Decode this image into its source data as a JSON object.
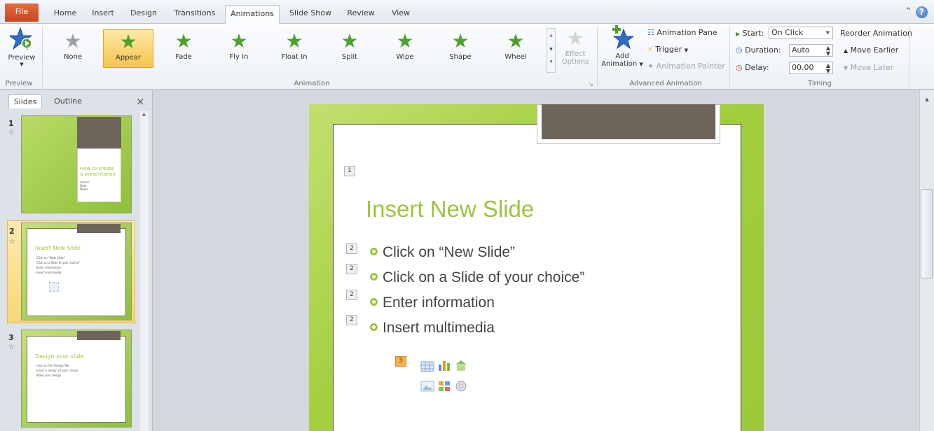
{
  "tabs": [
    "File",
    "Home",
    "Insert",
    "Design",
    "Transitions",
    "Animations",
    "Slide Show",
    "Review",
    "View"
  ],
  "ribbon": {
    "preview": {
      "label": "Preview",
      "group": "Preview"
    },
    "animations": [
      {
        "label": "None",
        "icon": "none-star-icon"
      },
      {
        "label": "Appear",
        "icon": "appear-star-icon"
      },
      {
        "label": "Fade",
        "icon": "fade-star-icon"
      },
      {
        "label": "Fly In",
        "icon": "fly-in-star-icon"
      },
      {
        "label": "Float In",
        "icon": "float-in-star-icon"
      },
      {
        "label": "Split",
        "icon": "split-star-icon"
      },
      {
        "label": "Wipe",
        "icon": "wipe-star-icon"
      },
      {
        "label": "Shape",
        "icon": "shape-star-icon"
      },
      {
        "label": "Wheel",
        "icon": "wheel-star-icon"
      }
    ],
    "selected_animation": "Appear",
    "effect_options": {
      "line1": "Effect",
      "line2": "Options"
    },
    "animation_group": "Animation",
    "add_animation": {
      "line1": "Add",
      "line2": "Animation"
    },
    "animation_pane": "Animation Pane",
    "trigger": "Trigger",
    "animation_painter": "Animation Painter",
    "advanced_group": "Advanced Animation",
    "start_label": "Start:",
    "start_value": "On Click",
    "duration_label": "Duration:",
    "duration_value": "Auto",
    "delay_label": "Delay:",
    "delay_value": "00.00",
    "timing_group": "Timing",
    "reorder_title": "Reorder Animation",
    "move_earlier": "Move Earlier",
    "move_later": "Move Later"
  },
  "pane": {
    "tabs": [
      "Slides",
      "Outline"
    ],
    "close": "×",
    "slides": [
      {
        "number": "1",
        "title_line1": "How to create",
        "title_line2": "a presentation",
        "lines": [
          "Author",
          "Date",
          "Notes"
        ]
      },
      {
        "number": "2",
        "title": "Insert New Slide",
        "lines": [
          "Click on “New Slide”",
          "Click on a Slide of your choice”",
          "Enter information",
          "Insert multimedia"
        ]
      },
      {
        "number": "3",
        "title": "Design your slide",
        "lines": [
          "Click on the Design Tab",
          "Insert a design of your choice",
          "Make your design"
        ]
      }
    ]
  },
  "slide": {
    "title": "Insert New Slide",
    "title_tag": "1",
    "bullets": [
      {
        "tag": "2",
        "text": "Click on “New Slide”"
      },
      {
        "tag": "2",
        "text": "Click on a Slide of your choice”"
      },
      {
        "tag": "2",
        "text": "Enter information"
      },
      {
        "tag": "2",
        "text": "Insert multimedia"
      }
    ],
    "content_tag": "3"
  },
  "colors": {
    "accent_green": "#9cc43d",
    "file_tab": "#d3532a",
    "selection": "#f6c44d"
  }
}
